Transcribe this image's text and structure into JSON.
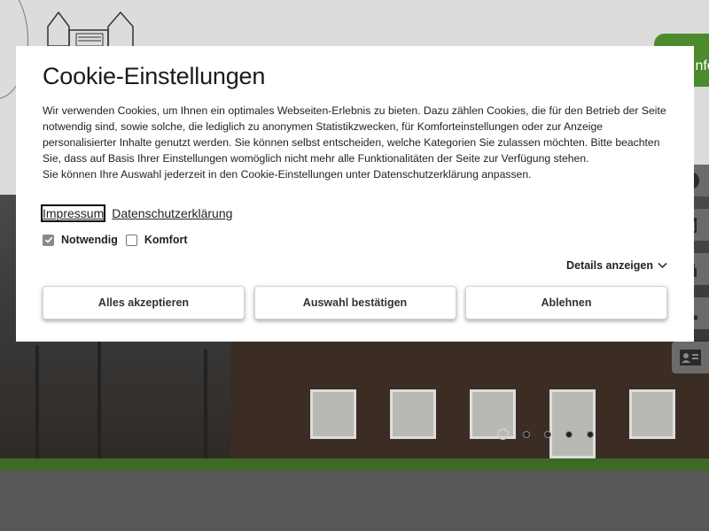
{
  "background": {
    "info_button_label": "Info",
    "side_tools": [
      {
        "icon": "info-icon"
      },
      {
        "icon": "edit-icon"
      },
      {
        "icon": "lock-icon"
      },
      {
        "icon": "phone-icon"
      },
      {
        "icon": "contact-card-icon"
      }
    ],
    "slider": {
      "slides": 5,
      "active_index": 0
    },
    "colors": {
      "green": "#3d6a26",
      "header_bg": "#dcdcdc"
    }
  },
  "cookie": {
    "title": "Cookie-Einstellungen",
    "text_lines": [
      "Wir verwenden Cookies, um Ihnen ein optimales Webseiten-Erlebnis zu bieten. Dazu zählen Cookies, die für den Betrieb der Seite",
      "notwendig sind, sowie solche, die lediglich zu anonymen Statistikzwecken, für Komforteinstellungen oder zur Anzeige",
      "personalisierter Inhalte genutzt werden. Sie können selbst entscheiden, welche Kategorien Sie zulassen möchten. Bitte beachten",
      "Sie, dass auf Basis Ihrer Einstellungen womöglich nicht mehr alle Funktionalitäten der Seite zur Verfügung stehen.",
      "Sie können Ihre Auswahl jederzeit in den Cookie-Einstellungen unter Datenschutzerklärung anpassen."
    ],
    "links": {
      "impressum": "Impressum",
      "datenschutz": "Datenschutzerklärung"
    },
    "options": {
      "notwendig": {
        "label": "Notwendig",
        "checked": true
      },
      "komfort": {
        "label": "Komfort",
        "checked": false
      }
    },
    "details_label": "Details anzeigen",
    "buttons": {
      "accept_all": "Alles akzeptieren",
      "confirm": "Auswahl bestätigen",
      "reject": "Ablehnen"
    }
  }
}
